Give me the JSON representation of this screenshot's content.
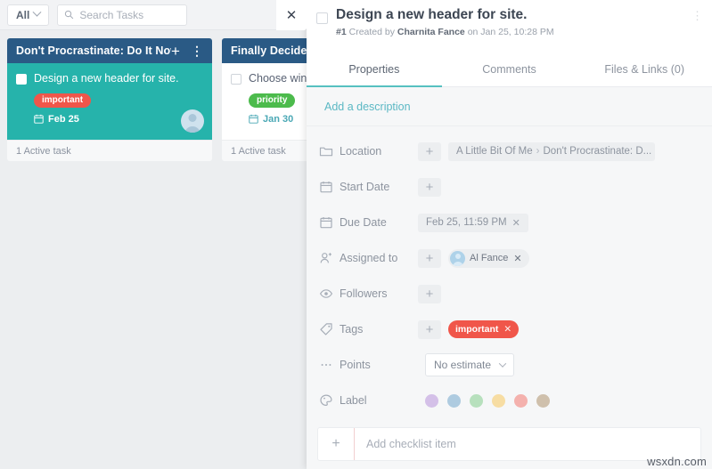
{
  "topbar": {
    "filter_label": "All",
    "filter_icon": "chevron-down-icon",
    "search_icon": "search-icon",
    "search_placeholder": "Search Tasks",
    "search_value": ""
  },
  "board": {
    "columns": [
      {
        "title": "Don't Procrastinate: Do It Now!",
        "add_icon": "plus-icon",
        "menu_icon": "kebab-menu-icon",
        "footer": "1 Active task",
        "card": {
          "title": "Design a new header for site.",
          "tag": "important",
          "tag_color": "#f0564a",
          "date": "Feb 25",
          "date_icon": "calendar-icon",
          "selected": true,
          "avatar": "assignee-avatar"
        }
      },
      {
        "title": "Finally Decided t",
        "footer": "1 Active task",
        "card": {
          "title": "Choose winne",
          "tag": "priority",
          "tag_color": "#4cbb4c",
          "date": "Jan 30",
          "date_icon": "calendar-icon",
          "selected": false
        }
      }
    ],
    "header_color": "#2a5a85",
    "selected_card_color": "#26b3ab"
  },
  "panel": {
    "close_icon": "close-icon",
    "checkbox": "task-complete-checkbox",
    "title": "Design a new header for site.",
    "meta_id": "#1",
    "meta_created_by_prefix": "Created by",
    "meta_author": "Charnita Fance",
    "meta_on": "on Jan 25, 10:28 PM",
    "kebab_icon": "kebab-menu-icon",
    "tabs": [
      {
        "label": "Properties",
        "active": true
      },
      {
        "label": "Comments",
        "active": false
      },
      {
        "label": "Files & Links (0)",
        "active": false
      }
    ],
    "accent_color": "#56c0c0",
    "description_placeholder": "Add a description",
    "properties": [
      {
        "key": "location",
        "label": "Location",
        "icon": "folder-icon",
        "add_icon": "plus-icon",
        "value_parts": [
          "A Little Bit Of Me",
          "Don't Procrastinate: D..."
        ],
        "separator": "›"
      },
      {
        "key": "start-date",
        "label": "Start Date",
        "icon": "calendar-icon",
        "add_icon": "plus-icon",
        "value": ""
      },
      {
        "key": "due-date",
        "label": "Due Date",
        "icon": "calendar-icon",
        "value": "Feb 25, 11:59 PM",
        "remove_icon": "close-icon"
      },
      {
        "key": "assigned-to",
        "label": "Assigned to",
        "icon": "person-add-icon",
        "add_icon": "plus-icon",
        "value": "Al Fance",
        "remove_icon": "close-icon"
      },
      {
        "key": "followers",
        "label": "Followers",
        "icon": "eye-icon",
        "add_icon": "plus-icon",
        "value": ""
      },
      {
        "key": "tags",
        "label": "Tags",
        "icon": "tag-icon",
        "add_icon": "plus-icon",
        "value": "important",
        "color": "#f0564a",
        "remove_icon": "close-icon"
      },
      {
        "key": "points",
        "label": "Points",
        "icon": "ellipsis-icon",
        "value": "No estimate",
        "dropdown_icon": "chevron-down-icon"
      },
      {
        "key": "label",
        "label": "Label",
        "icon": "palette-icon",
        "swatches": [
          "#d4c0e8",
          "#aecbe0",
          "#b7e0bd",
          "#f7dda3",
          "#f4b1ad",
          "#cfc0ac"
        ]
      }
    ],
    "checklist": {
      "add_icon": "plus-icon",
      "placeholder": "Add checklist item",
      "value": ""
    }
  },
  "watermark": "wsxdn.com"
}
